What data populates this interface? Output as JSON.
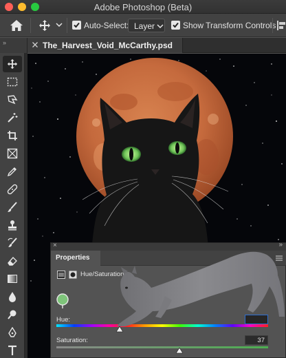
{
  "window": {
    "app_title": "Adobe Photoshop (Beta)"
  },
  "options_bar": {
    "auto_select_label": "Auto-Select:",
    "auto_select_checked": true,
    "layer_select_value": "Layer",
    "show_transform_label": "Show Transform Controls",
    "show_transform_checked": true
  },
  "document": {
    "tab_title": "The_Harvest_Void_McCarthy.psd"
  },
  "toolbar": {
    "collapse_glyph": "»",
    "tools": [
      "move-tool",
      "marquee-tool",
      "lasso-tool",
      "magic-wand-tool",
      "crop-tool",
      "frame-tool",
      "eyedropper-tool",
      "healing-brush-tool",
      "brush-tool",
      "clone-stamp-tool",
      "history-brush-tool",
      "eraser-tool",
      "gradient-tool",
      "blur-tool",
      "dodge-tool",
      "pen-tool",
      "type-tool"
    ],
    "active_tool": "move-tool"
  },
  "properties": {
    "panel_title": "Properties",
    "adjustment_title": "Hue/Saturation",
    "hue_label": "Hue:",
    "hue_value": "",
    "saturation_label": "Saturation:",
    "saturation_value": "37",
    "hue_slider_fraction": 0.3,
    "saturation_slider_fraction": 0.58,
    "swatch_color": "#7ec47a"
  },
  "colors": {
    "moon": "#c56a3d",
    "canvas_bg": "#05060a",
    "cat_eye": "#7dd46a",
    "focus_blue": "#2e6fd2"
  }
}
